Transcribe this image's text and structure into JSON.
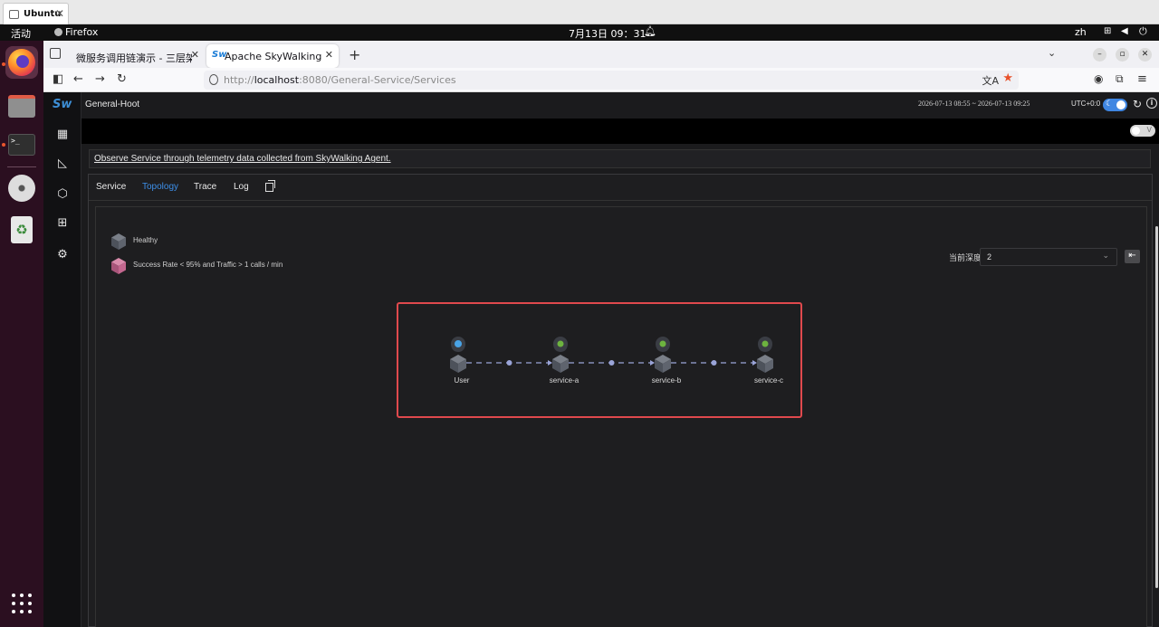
{
  "vm": {
    "tab_label": "Ubuntu"
  },
  "system_bar": {
    "activities": "活动",
    "app_name": "Firefox",
    "clock": "7月13日  09：31",
    "language": "zh"
  },
  "browser": {
    "tabs": [
      {
        "label": "微服务调用链演示 - 三层架构"
      },
      {
        "label": "Apache SkyWalking"
      }
    ],
    "url_host_prefix": "http://",
    "url_host": "localhost",
    "url_rest": ":8080/General-Service/Services"
  },
  "app": {
    "breadcrumb": "General-Hoot",
    "time_range": "2026-07-13 08:55 ~ 2026-07-13 09:25",
    "timezone": "UTC+0:0",
    "toggle_label": "V",
    "description": "Observe Service through telemetry data collected from SkyWalking Agent.",
    "tabs": [
      "Service",
      "Topology",
      "Trace",
      "Log"
    ],
    "active_tab": "Topology",
    "legend": [
      {
        "label": "Healthy",
        "color": "#5f646e"
      },
      {
        "label": "Success Rate < 95% and Traffic > 1 calls / min",
        "color": "#c4678f"
      }
    ],
    "depth_label": "当前深度",
    "depth_value": "2",
    "topology": {
      "nodes": [
        {
          "name": "User",
          "badge": "user"
        },
        {
          "name": "service-a",
          "badge": "spring"
        },
        {
          "name": "service-b",
          "badge": "spring"
        },
        {
          "name": "service-c",
          "badge": "spring"
        }
      ],
      "edges": [
        [
          "User",
          "service-a"
        ],
        [
          "service-a",
          "service-b"
        ],
        [
          "service-b",
          "service-c"
        ]
      ]
    }
  },
  "colors": {
    "accent": "#3d8fe8",
    "highlight": "#e0494d",
    "node_healthy": "#5f646e",
    "spring_badge": "#6db33f",
    "edge": "#9aa4d8"
  }
}
